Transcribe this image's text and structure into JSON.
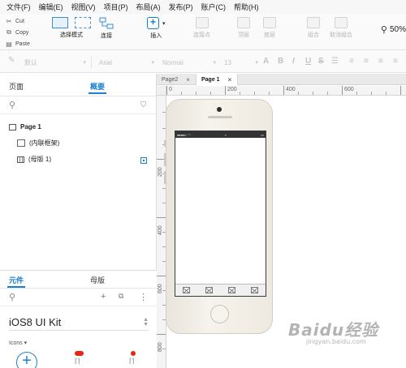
{
  "menu": [
    "文件(F)",
    "编辑(E)",
    "视图(V)",
    "项目(P)",
    "布局(A)",
    "发布(P)",
    "账户(C)",
    "帮助(H)"
  ],
  "toolbar": {
    "cut": "Cut",
    "copy": "Copy",
    "paste": "Paste",
    "select_mode": "选择模式",
    "connect": "连接",
    "insert": "插入",
    "connect_point": "连接点",
    "top": "顶层",
    "bottom": "底层",
    "group": "组合",
    "ungroup": "取消组合",
    "zoom": "50%"
  },
  "format": {
    "style": "默认",
    "font": "Arial",
    "weight": "Normal",
    "size": "13"
  },
  "left_panel": {
    "tab_pages": "页面",
    "tab_outline": "概要",
    "page_root": "Page 1",
    "items": [
      "(内联框架)",
      "(母版 1)"
    ]
  },
  "widgets": {
    "tab_widgets": "元件",
    "tab_masters": "母版",
    "library": "iOS8 UI Kit",
    "category": "Icons ▾"
  },
  "canvas": {
    "tabs": [
      "Page2",
      "Page 1"
    ],
    "ruler_h": [
      "0",
      "200",
      "400",
      "600"
    ],
    "ruler_v": [
      "200",
      "400",
      "600",
      "800"
    ]
  },
  "watermark": {
    "brand": "Baidu经验",
    "url": "jingyan.baidu.com"
  },
  "colors": {
    "accent": "#1a7fd0",
    "badge": "#ee2211"
  }
}
